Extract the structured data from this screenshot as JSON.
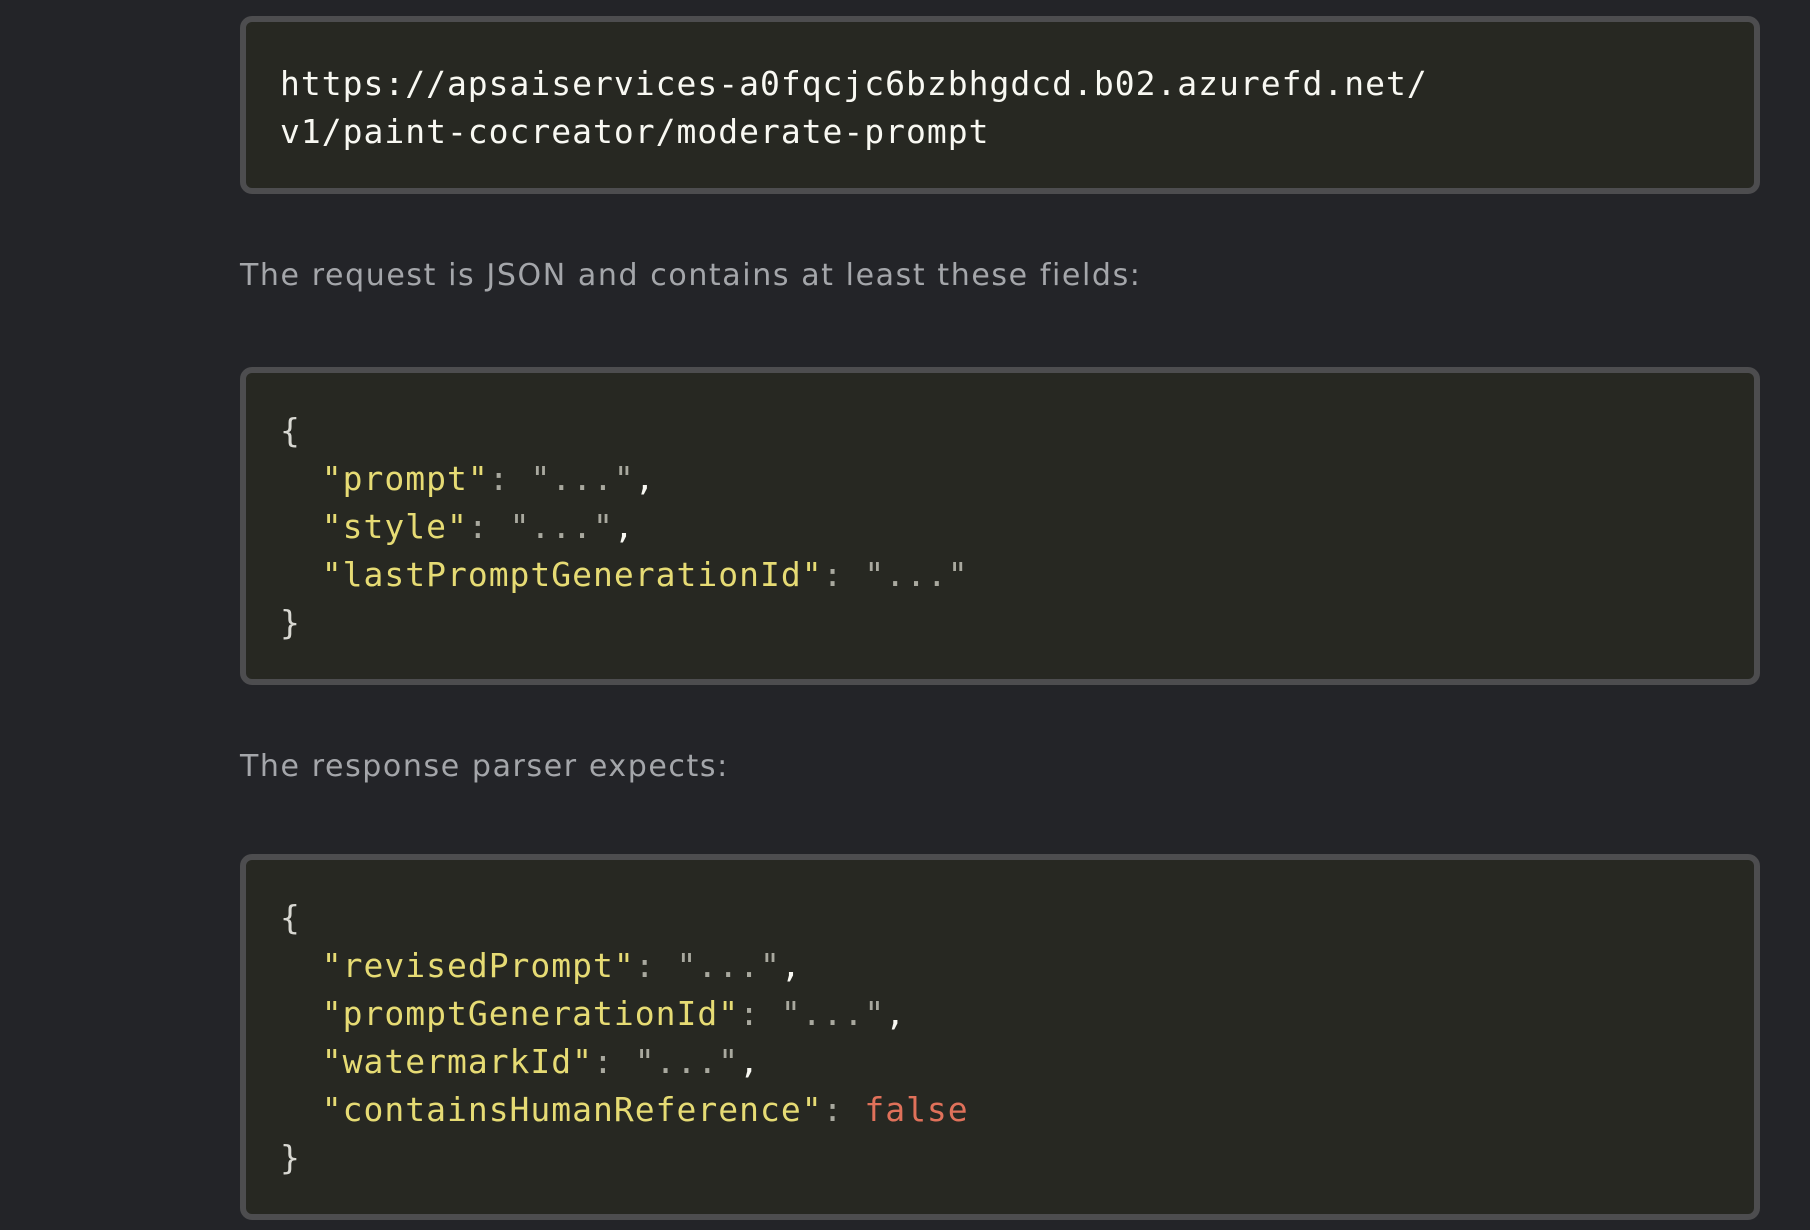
{
  "endpoint": {
    "line1": "https://apsaiservices-a0fqcjc6bzbhgdcd.b02.azurefd.net/",
    "line2": "v1/paint-cocreator/moderate-prompt"
  },
  "request_intro": "The request is JSON and contains at least these fields:",
  "request_json": {
    "open_brace": "{",
    "close_brace": "}",
    "fields": [
      {
        "key": "\"prompt\"",
        "sep": ": ",
        "value": "\"...\"",
        "comma": ","
      },
      {
        "key": "\"style\"",
        "sep": ": ",
        "value": "\"...\"",
        "comma": ","
      },
      {
        "key": "\"lastPromptGenerationId\"",
        "sep": ": ",
        "value": "\"...\"",
        "comma": ""
      }
    ]
  },
  "response_intro": "The response parser expects:",
  "response_json": {
    "open_brace": "{",
    "close_brace": "}",
    "fields": [
      {
        "key": "\"revisedPrompt\"",
        "sep": ": ",
        "value": "\"...\"",
        "comma": ","
      },
      {
        "key": "\"promptGenerationId\"",
        "sep": ": ",
        "value": "\"...\"",
        "comma": ","
      },
      {
        "key": "\"watermarkId\"",
        "sep": ": ",
        "value": "\"...\"",
        "comma": ","
      },
      {
        "key": "\"containsHumanReference\"",
        "sep": ": ",
        "value": "false",
        "comma": ""
      }
    ]
  },
  "colors": {
    "background": "#232428",
    "code_background": "#272822",
    "code_border": "#4d4d4f",
    "json_key": "#e6db74",
    "json_string": "#a9a99f",
    "json_boolean": "#e0715a",
    "prose_text": "#a4a6aa"
  }
}
